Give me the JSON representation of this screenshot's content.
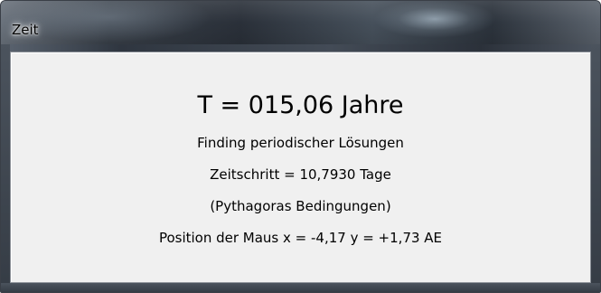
{
  "window": {
    "title": "Zeit"
  },
  "content": {
    "time_display": "T = 015,06 Jahre",
    "mode": "Finding periodischer Lösungen",
    "step": "Zeitschritt = 10,7930 Tage",
    "condition": "(Pythagoras Bedingungen)",
    "mouse_position": "Position der Maus x = -4,17 y = +1,73 AE"
  },
  "colors": {
    "client_background": "#f0f0f0",
    "text": "#000000",
    "frame": "#353c45"
  }
}
